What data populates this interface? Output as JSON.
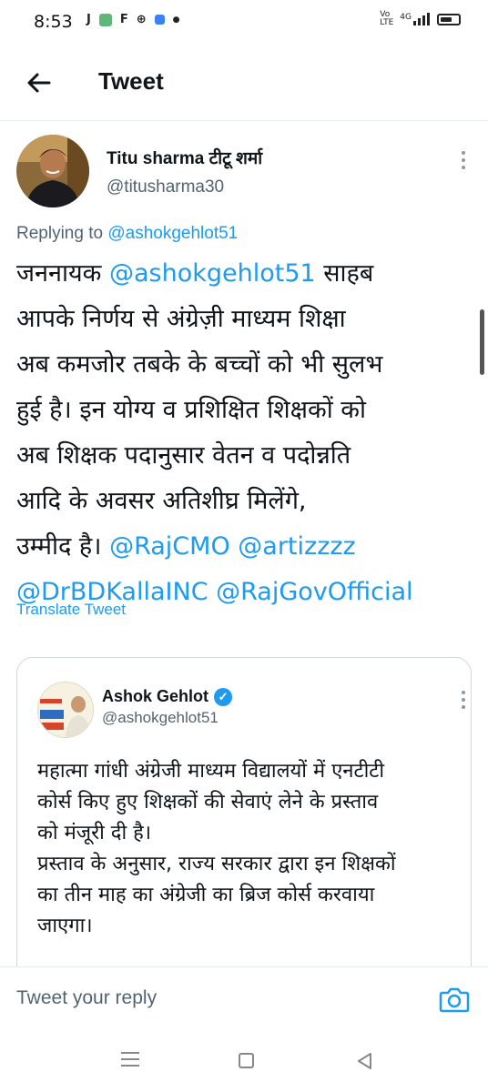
{
  "status": {
    "time": "8:53",
    "left_icons": [
      "J",
      "app-icon",
      "F",
      "ball-icon",
      "app-icon-2",
      "•"
    ],
    "network": "4G",
    "volte": "Vo LTE"
  },
  "header": {
    "title": "Tweet"
  },
  "tweet": {
    "author_name": "Titu sharma टीटू शर्मा",
    "author_handle": "@titusharma30",
    "replying_label": "Replying to",
    "replying_handle": "@ashokgehlot51",
    "lines": [
      {
        "pre": "जननायक ",
        "link": "@ashokgehlot51",
        "post": " साहब"
      },
      {
        "pre": "आपके निर्णय से अंग्रेज़ी माध्यम शिक्षा",
        "link": "",
        "post": ""
      },
      {
        "pre": "अब कमजोर तबके के बच्चों को भी सुलभ",
        "link": "",
        "post": ""
      },
      {
        "pre": "हुई है। इन योग्य व प्रशिक्षित शिक्षकों को",
        "link": "",
        "post": ""
      },
      {
        "pre": "अब शिक्षक पदानुसार वेतन व पदोन्नति",
        "link": "",
        "post": ""
      },
      {
        "pre": "आदि के अवसर अतिशीघ्र मिलेंगे,",
        "link": "",
        "post": ""
      },
      {
        "pre": "उम्मीद है। ",
        "link": "@RajCMO @artizzzz",
        "post": ""
      },
      {
        "pre": "",
        "link": "@DrBDKallaINC @RajGovOfficial",
        "post": ""
      }
    ],
    "translate_label": "Translate Tweet"
  },
  "quote": {
    "author_name": "Ashok Gehlot",
    "author_handle": "@ashokgehlot51",
    "lines": [
      "महात्मा गांधी अंग्रेजी माध्यम विद्यालयों में एनटीटी",
      "कोर्स किए हुए शिक्षकों की सेवाएं लेने के प्रस्ताव",
      "को मंजूरी दी है।",
      "प्रस्ताव के अनुसार, राज्य सरकार द्वारा इन शिक्षकों",
      "का तीन माह का अंग्रेजी का ब्रिज कोर्स करवाया",
      "जाएगा।"
    ]
  },
  "reply": {
    "placeholder": "Tweet your reply"
  },
  "colors": {
    "link": "#1d9bf0",
    "secondary_text": "#536471",
    "border": "#cfd9de"
  }
}
